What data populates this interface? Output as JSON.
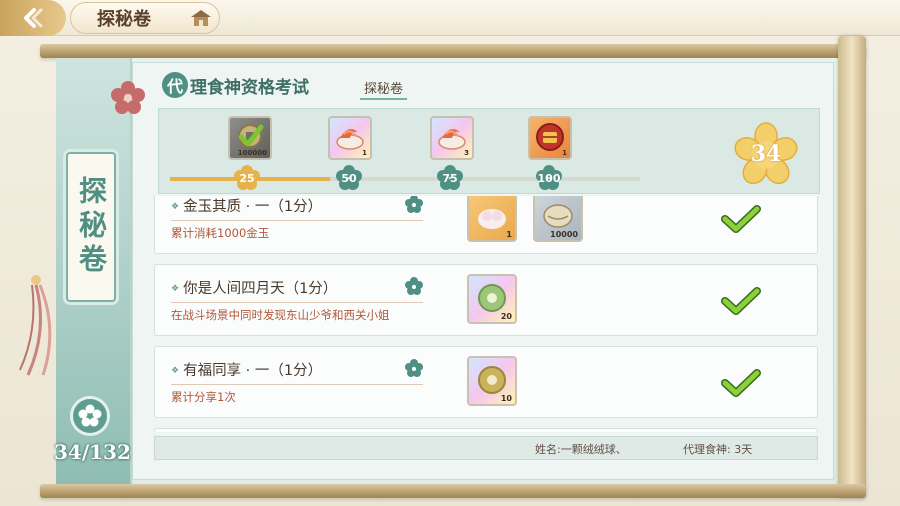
{
  "top_bar": {
    "title": "探秘卷",
    "back_icon": "back-arrow-icon",
    "home_icon": "home-icon"
  },
  "banner": {
    "label": "探秘卷",
    "progress": "34/132"
  },
  "header": {
    "badge": "代",
    "title": "理食神资格考试",
    "subtitle": "探秘卷"
  },
  "reward_track": {
    "current_score": "34",
    "progress_fraction": 0.34,
    "milestones": [
      {
        "value": "25",
        "reward_qty": "100000",
        "claimed": true
      },
      {
        "value": "50",
        "reward_qty": "1",
        "claimed": false
      },
      {
        "value": "75",
        "reward_qty": "3",
        "claimed": false
      },
      {
        "value": "100",
        "reward_qty": "1",
        "claimed": false
      }
    ]
  },
  "tasks": [
    {
      "name": "金玉其质 · 一（1分）",
      "desc": "累计消耗1000金玉",
      "rewards": [
        {
          "qty": "1"
        },
        {
          "qty": "10000"
        }
      ],
      "completed": true
    },
    {
      "name": "你是人间四月天（1分）",
      "desc": "在战斗场景中同时发现东山少爷和西关小姐",
      "rewards": [
        {
          "qty": "20"
        }
      ],
      "completed": true
    },
    {
      "name": "有福同享 · 一（1分）",
      "desc": "累计分享1次",
      "rewards": [
        {
          "qty": "10"
        }
      ],
      "completed": true
    }
  ],
  "footer": {
    "name_text": "姓名:一颗绒绒球、",
    "days_text": "代理食神: 3天"
  },
  "colors": {
    "accent": "#4f8f84",
    "progress": "#e5b24b",
    "check": "#7bc52e"
  }
}
